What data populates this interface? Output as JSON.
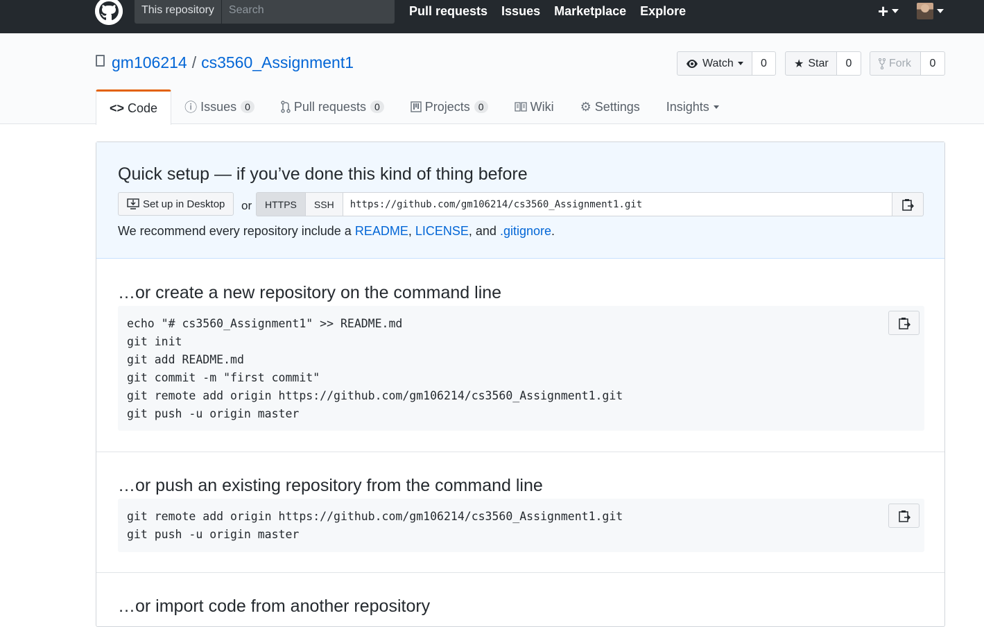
{
  "topnav": {
    "scope_label": "This repository",
    "search_placeholder": "Search",
    "links": [
      "Pull requests",
      "Issues",
      "Marketplace",
      "Explore"
    ],
    "plus": "+"
  },
  "repo": {
    "owner": "gm106214",
    "separator": "/",
    "name": "cs3560_Assignment1",
    "watch_label": "Watch",
    "watch_count": "0",
    "star_label": "Star",
    "star_count": "0",
    "fork_label": "Fork",
    "fork_count": "0"
  },
  "tabs": [
    {
      "label": "Code",
      "icon": "code-icon"
    },
    {
      "label": "Issues",
      "icon": "issue-icon",
      "count": "0"
    },
    {
      "label": "Pull requests",
      "icon": "pull-request-icon",
      "count": "0"
    },
    {
      "label": "Projects",
      "icon": "project-icon",
      "count": "0"
    },
    {
      "label": "Wiki",
      "icon": "book-icon"
    },
    {
      "label": "Settings",
      "icon": "gear-icon"
    },
    {
      "label": "Insights"
    }
  ],
  "quick_setup": {
    "title": "Quick setup — if you’ve done this kind of thing before",
    "desktop_button": "Set up in Desktop",
    "or": "or",
    "https": "HTTPS",
    "ssh": "SSH",
    "url": "https://github.com/gm106214/cs3560_Assignment1.git",
    "recommend_prefix": "We recommend every repository include a ",
    "readme": "README",
    "comma1": ", ",
    "license": "LICENSE",
    "and": ", and ",
    "gitignore": ".gitignore",
    "period": "."
  },
  "create_section": {
    "title": "…or create a new repository on the command line",
    "lines": [
      "echo \"# cs3560_Assignment1\" >> README.md",
      "git init",
      "git add README.md",
      "git commit -m \"first commit\"",
      "git remote add origin https://github.com/gm106214/cs3560_Assignment1.git",
      "git push -u origin master"
    ]
  },
  "push_section": {
    "title": "…or push an existing repository from the command line",
    "lines": [
      "git remote add origin https://github.com/gm106214/cs3560_Assignment1.git",
      "git push -u origin master"
    ]
  },
  "import_section": {
    "title": "…or import code from another repository"
  },
  "colors": {
    "nav_bg": "#24292e",
    "link": "#0366d6",
    "tab_accent": "#e36209",
    "quick_bg": "#f1f8ff"
  }
}
